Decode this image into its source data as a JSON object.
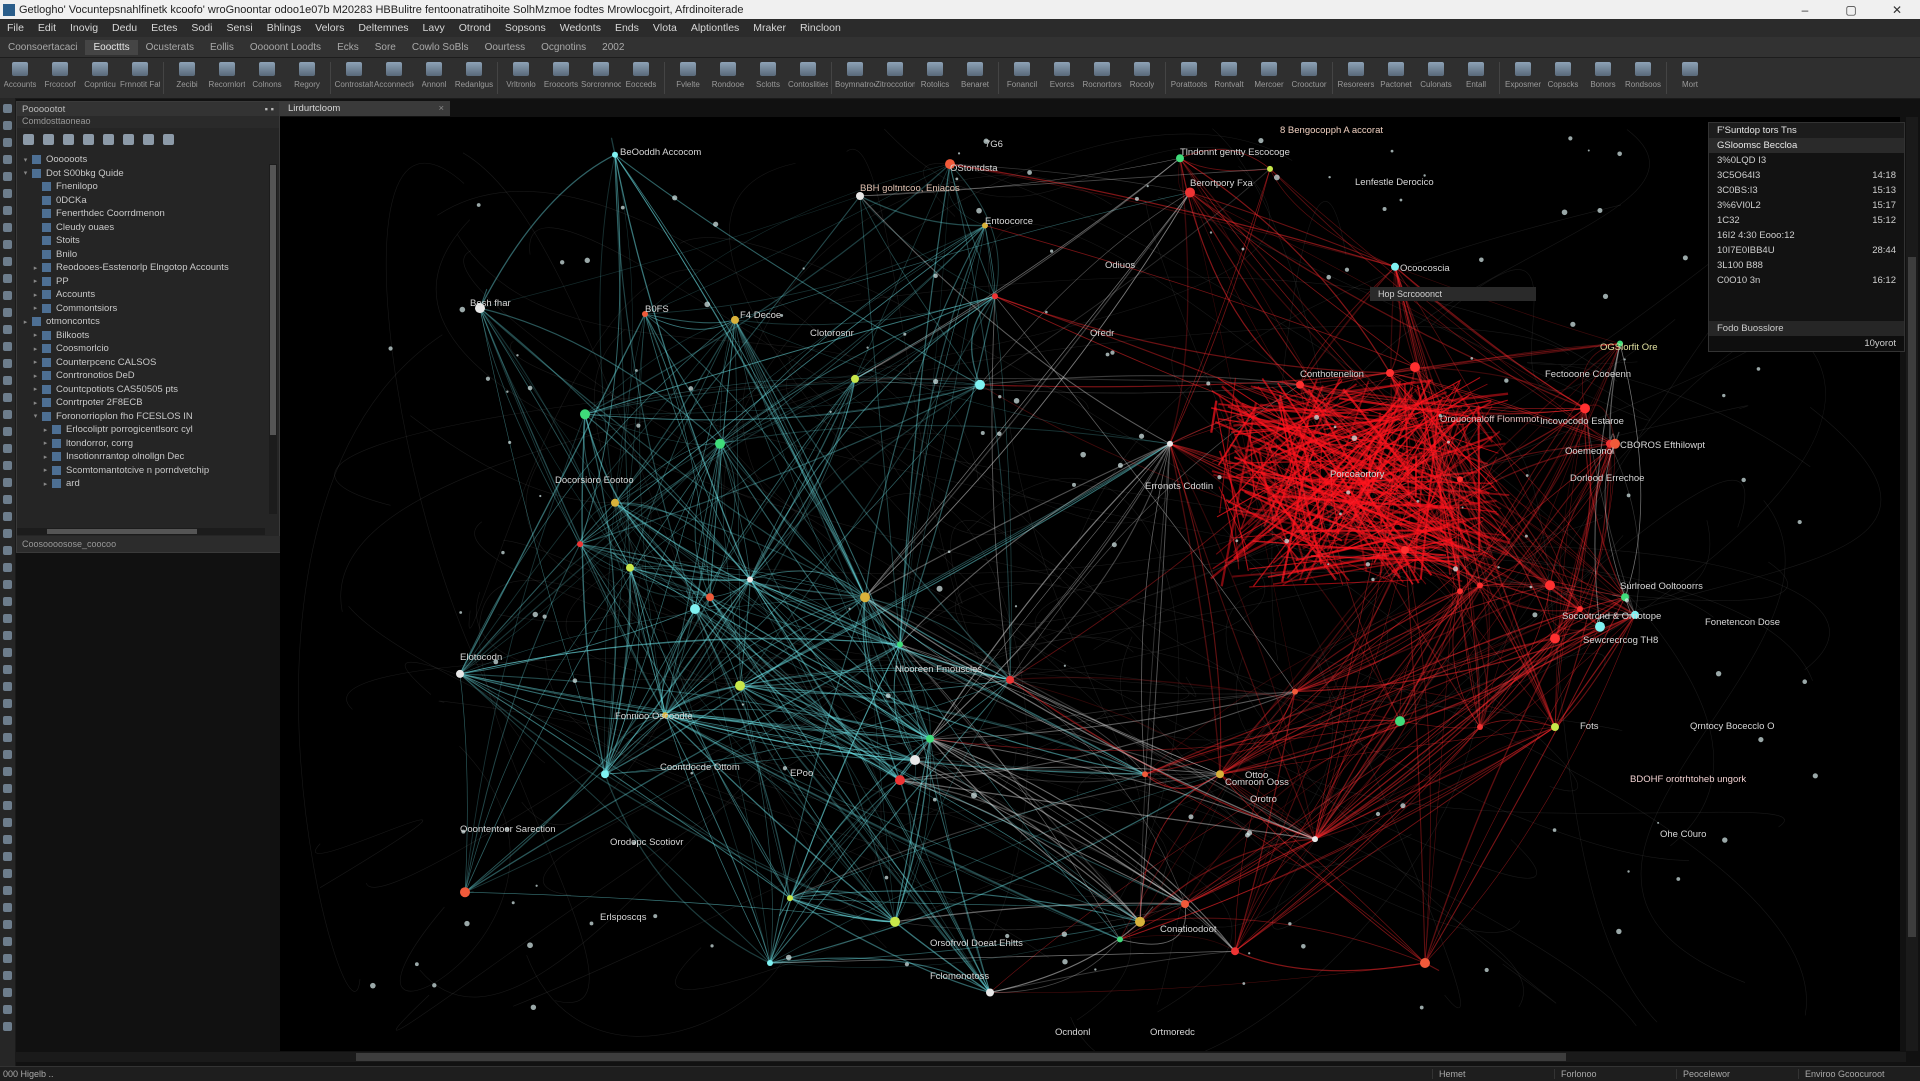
{
  "window": {
    "title": "Getlogho' Vocuntepsnahlfinetk kcoofo' wroGnoontar odoo1e07b M20283 HBBulitre fentoonatratihoite SolhMzmoe fodtes Mrowlocgoirt, Afrdinoiterade",
    "minimize_label": "–",
    "maximize_label": "▢",
    "close_label": "✕"
  },
  "menu": [
    "File",
    "Edit",
    "Inovig",
    "Dedu",
    "Ectes",
    "Sodi",
    "Sensi",
    "Bhlings",
    "Velors",
    "Deltemnes",
    "Lavy",
    "Otrond",
    "Sopsons",
    "Wedonts",
    "Ends",
    "Vlota",
    "Alptiontles",
    "Mraker",
    "Rincloon"
  ],
  "tabs": [
    {
      "label": "Coonsoertacaci"
    },
    {
      "label": "Eoocttts",
      "active": true
    },
    {
      "label": "Ocusterats"
    },
    {
      "label": "Eollis"
    },
    {
      "label": "Ooooont Loodts"
    },
    {
      "label": "Ecks"
    },
    {
      "label": "Sore"
    },
    {
      "label": "Cowlo SoBls"
    },
    {
      "label": "Oourtess"
    },
    {
      "label": "Ocgnotins"
    },
    {
      "label": "2002"
    }
  ],
  "toolbar": [
    "Accounts",
    "Frcocoof",
    "Copnticu",
    "Frnnotit Fattics",
    "Zecibi",
    "Recornlort",
    "Colnons",
    "Regory",
    "Controstalt",
    "Acconnection",
    "Annonl",
    "Redanlgus",
    "Vrltronlo",
    "Eroocorts",
    "Sorcronnocs",
    "Eocceds",
    "Fvlelte",
    "Rondooe",
    "Sclotts",
    "Contoslities",
    "Boymnatroes",
    "Zitroccotiom",
    "Rotolics",
    "Benaret",
    "Fonancil",
    "Evorcs",
    "Rocnortors",
    "Rocoly",
    "Porattoots",
    "Rontvalt",
    "Mercoer",
    "Crooctuor",
    "Resoreers",
    "Pactonet",
    "Culonats",
    "Entall",
    "Exposmer",
    "Copscks",
    "Bonors",
    "Rondsoos",
    "Mort"
  ],
  "left_panel": {
    "title": "Poooootot",
    "subtitle": "Comdosttaoneao",
    "tree": [
      {
        "label": "Oooooots",
        "depth": 0,
        "expander": "▾"
      },
      {
        "label": "Dot S00bkg Quide",
        "depth": 0,
        "expander": "▾"
      },
      {
        "label": "Fnenilopo",
        "depth": 1,
        "expander": ""
      },
      {
        "label": "0DCKa",
        "depth": 1,
        "expander": ""
      },
      {
        "label": "Fenerthdec Coorrdmenon",
        "depth": 1,
        "expander": ""
      },
      {
        "label": "Cleudy ouaes",
        "depth": 1,
        "expander": ""
      },
      {
        "label": "Stoits",
        "depth": 1,
        "expander": ""
      },
      {
        "label": "Bnilo",
        "depth": 1,
        "expander": ""
      },
      {
        "label": "Reodooes-Esstenorlp Elngotop Accounts",
        "depth": 1,
        "expander": "▸"
      },
      {
        "label": "PP",
        "depth": 1,
        "expander": "▸"
      },
      {
        "label": "Accounts",
        "depth": 1,
        "expander": "▸"
      },
      {
        "label": "Commontsiors",
        "depth": 1,
        "expander": "▸"
      },
      {
        "label": "otmoncontcs",
        "depth": 0,
        "expander": "▸"
      },
      {
        "label": "Bilkoots",
        "depth": 1,
        "expander": "▸"
      },
      {
        "label": "Coosmorlcio",
        "depth": 1,
        "expander": "▸"
      },
      {
        "label": "Counterpcenc CALSOS",
        "depth": 1,
        "expander": "▸"
      },
      {
        "label": "Conrtronotios DeD",
        "depth": 1,
        "expander": "▸"
      },
      {
        "label": "Countcpotiots CAS50505 pts",
        "depth": 1,
        "expander": "▸"
      },
      {
        "label": "Conrtrpoter 2F8ECB",
        "depth": 1,
        "expander": "▸"
      },
      {
        "label": "Foronorrioplon fho FCESLOS IN",
        "depth": 1,
        "expander": "▾"
      },
      {
        "label": "Erlocoliptr porrogicentlsorc cyl",
        "depth": 2,
        "expander": "▸"
      },
      {
        "label": "ltondorror, corrg",
        "depth": 2,
        "expander": "▸"
      },
      {
        "label": "Insotionrrantop olnollgn Dec",
        "depth": 2,
        "expander": "▸"
      },
      {
        "label": "Scomtomantotcive n porndvetchip",
        "depth": 2,
        "expander": "▸"
      },
      {
        "label": "ard",
        "depth": 2,
        "expander": "▸"
      }
    ],
    "footer": "Coosoooosose_coocoo"
  },
  "document_tab": {
    "label": "Lirdurtcloom",
    "close": "×"
  },
  "graph": {
    "labels": [
      {
        "text": "BeOoddh Accocom",
        "color": "#d8d8d8"
      },
      {
        "text": "7G6",
        "color": "#d8d8d8"
      },
      {
        "text": "BBH goltntcoo, Eniacos",
        "color": "#e0c0b0"
      },
      {
        "text": "OStontdsta",
        "color": "#d8d8d8"
      },
      {
        "text": "Entoocorce",
        "color": "#d8d8d8"
      },
      {
        "text": "Odiuos",
        "color": "#d8d8d8"
      },
      {
        "text": "Tlndonnt gentty Escocoge",
        "color": "#d8d8d8"
      },
      {
        "text": "8 Bengocopph A accorat",
        "color": "#f0d0c0"
      },
      {
        "text": "Berortpory Fxa",
        "color": "#d8d8d8"
      },
      {
        "text": "Lenfestle Derocico",
        "color": "#d8d8d8"
      },
      {
        "text": "Ocoocoscia",
        "color": "#d8d8d8"
      },
      {
        "text": "Besh fhar",
        "color": "#d8d8d8"
      },
      {
        "text": "B0FS",
        "color": "#d8d8d8"
      },
      {
        "text": "F4 Decoe",
        "color": "#d8d8d8"
      },
      {
        "text": "OGSlorfit Ore",
        "color": "#e0e0a0"
      },
      {
        "text": "Oredr",
        "color": "#d8d8d8"
      },
      {
        "text": "Clotorosnr",
        "color": "#d8d8d8"
      },
      {
        "text": "Orouocnaloff Flonmmot",
        "color": "#e0c0c0"
      },
      {
        "text": "Incovocodo Estaroe",
        "color": "#d8d8d8"
      },
      {
        "text": "Dorlood Errechoe",
        "color": "#d8d8d8"
      },
      {
        "text": "CBOROS Efthilowpt",
        "color": "#d8d8d8"
      },
      {
        "text": "Fectooone Cooeenn",
        "color": "#d8d8d8"
      },
      {
        "text": "Ooemeonol",
        "color": "#d8d8d8"
      },
      {
        "text": "Surlroed Ooltooorrs",
        "color": "#d8d8d8"
      },
      {
        "text": "Socootrcnd & Ornotope",
        "color": "#d8d8d8"
      },
      {
        "text": "Sewcrecrcog TH8",
        "color": "#d8d8d8"
      },
      {
        "text": "Fots",
        "color": "#d8d8d8"
      },
      {
        "text": "Qrntocy Bocecclo O",
        "color": "#d8d8d8"
      },
      {
        "text": "BDOHF orotrhtoheb ungork",
        "color": "#f0d0d0"
      },
      {
        "text": "Fonetencon Dose",
        "color": "#d8d8d8"
      },
      {
        "text": "Ohe C0uro",
        "color": "#d8d8d8"
      },
      {
        "text": "Conthotenelion",
        "color": "#d8d8d8"
      },
      {
        "text": "Erronots Cdotlin",
        "color": "#d8d8d8"
      },
      {
        "text": "Porcoaortory",
        "color": "#d8d8d8"
      },
      {
        "text": "Docorsioro Eootoo",
        "color": "#d8d8d8"
      },
      {
        "text": "Nlooreen Fmouscles",
        "color": "#d8d8d8"
      },
      {
        "text": "Fonnioo Oscoodte",
        "color": "#d8d8d8"
      },
      {
        "text": "Elotocodn",
        "color": "#d8d8d8"
      },
      {
        "text": "Coontdocde Ottom",
        "color": "#d8d8d8"
      },
      {
        "text": "Orodopc Scotiovr",
        "color": "#d8d8d8"
      },
      {
        "text": "Ooontentoor Sarection",
        "color": "#d8d8d8"
      },
      {
        "text": "Ottoo",
        "color": "#d8d8d8"
      },
      {
        "text": "Comroon Ooss",
        "color": "#d8d8d8"
      },
      {
        "text": "Orotro",
        "color": "#d8d8d8"
      },
      {
        "text": "EPoo",
        "color": "#d8d8d8"
      },
      {
        "text": "Erlsposcqs",
        "color": "#d8d8d8"
      },
      {
        "text": "Orsofrvol Doeat Ehltts",
        "color": "#d8d8d8"
      },
      {
        "text": "Conatioodoot",
        "color": "#d8d8d8"
      },
      {
        "text": "Fclomonotoss",
        "color": "#d8d8d8"
      },
      {
        "text": "Ortmoredc",
        "color": "#d8d8d8"
      },
      {
        "text": "Ocndonl",
        "color": "#d8d8d8"
      }
    ]
  },
  "right_panel": {
    "header1": "F'Suntdop tors Tns",
    "header2": "GSloomsc Beccloa",
    "rows": [
      {
        "name": "3%0LQD I3",
        "value": ""
      },
      {
        "name": "3C5O64I3",
        "value": "14:18"
      },
      {
        "name": "3C0BS:I3",
        "value": "15:13"
      },
      {
        "name": "3%6VI0L2",
        "value": "15:17"
      },
      {
        "name": "1C32",
        "value": "15:12"
      },
      {
        "name": "16I2 4:30 Eooo:12",
        "value": ""
      },
      {
        "name": "10I7E0IBB4U",
        "value": "28:44"
      },
      {
        "name": "3L100 B88",
        "value": ""
      },
      {
        "name": "C0O10 3n",
        "value": "16:12"
      }
    ],
    "footer1": "Fodo Buosslore",
    "footer2": "10yorot"
  },
  "overlay_card": {
    "text": "Hop Scrcooonct"
  },
  "status": {
    "left": "000  Higelb ..",
    "segments": [
      "Hemet",
      "Forlonoo",
      "Peocelewor",
      "Enviroo Gcoocuroot"
    ]
  }
}
